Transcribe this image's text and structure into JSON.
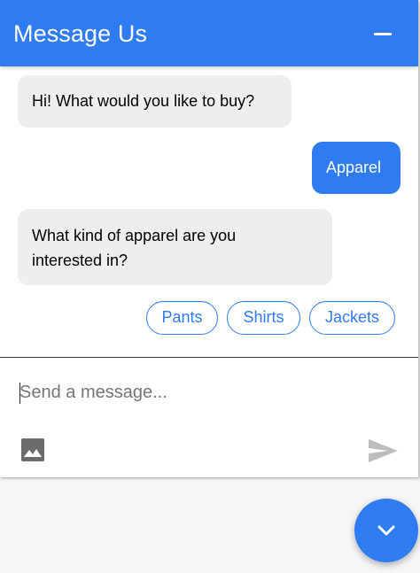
{
  "header": {
    "title": "Message Us",
    "minimize_icon": "minimize-icon"
  },
  "messages": [
    {
      "sender": "bot",
      "lines": [
        "Hi! What would you like to buy?"
      ]
    },
    {
      "sender": "user",
      "lines": [
        "Apparel"
      ]
    },
    {
      "sender": "bot",
      "lines": [
        "What kind of apparel are you",
        "interested in?"
      ]
    }
  ],
  "quick_replies": [
    "Pants",
    "Shirts",
    "Jackets"
  ],
  "composer": {
    "placeholder": "Send a message...",
    "value": "",
    "image_icon": "image-icon",
    "send_icon": "send-icon"
  },
  "fab": {
    "icon": "chevron-down-icon"
  },
  "colors": {
    "accent": "#2f7bf2",
    "bot_bubble": "#eeeeee",
    "background": "#f6f6f6"
  }
}
